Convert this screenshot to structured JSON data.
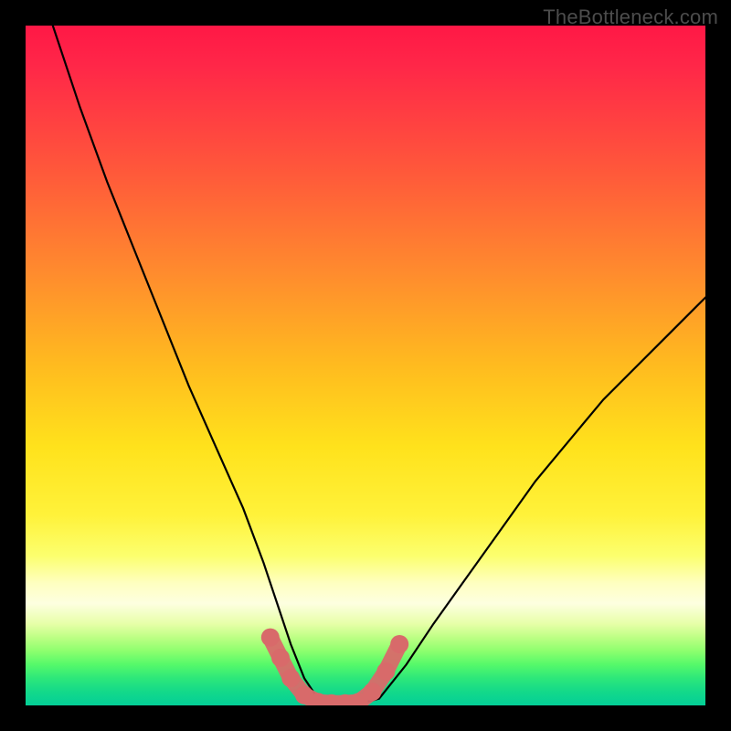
{
  "watermark": "TheBottleneck.com",
  "chart_data": {
    "type": "line",
    "title": "",
    "xlabel": "",
    "ylabel": "",
    "xlim": [
      0,
      100
    ],
    "ylim": [
      0,
      100
    ],
    "series": [
      {
        "name": "bottleneck-curve",
        "x": [
          4,
          8,
          12,
          16,
          20,
          24,
          28,
          32,
          35,
          37,
          39,
          41,
          43,
          45,
          48,
          52,
          56,
          60,
          65,
          70,
          75,
          80,
          85,
          90,
          95,
          100
        ],
        "y": [
          100,
          88,
          77,
          67,
          57,
          47,
          38,
          29,
          21,
          15,
          9,
          4,
          1,
          0,
          0,
          1,
          6,
          12,
          19,
          26,
          33,
          39,
          45,
          50,
          55,
          60
        ]
      }
    ],
    "markers": {
      "name": "optimum-band",
      "points": [
        {
          "x": 36,
          "y": 10
        },
        {
          "x": 37.5,
          "y": 7
        },
        {
          "x": 39,
          "y": 4
        },
        {
          "x": 41,
          "y": 1.5
        },
        {
          "x": 43,
          "y": 0.5
        },
        {
          "x": 45,
          "y": 0.3
        },
        {
          "x": 47,
          "y": 0.3
        },
        {
          "x": 49,
          "y": 0.5
        },
        {
          "x": 51,
          "y": 2
        },
        {
          "x": 53,
          "y": 5
        },
        {
          "x": 55,
          "y": 9
        }
      ],
      "color": "#d86a6a"
    },
    "background_gradient": {
      "top": "#ff1846",
      "mid": "#fff23a",
      "bottom": "#04cf97"
    }
  }
}
